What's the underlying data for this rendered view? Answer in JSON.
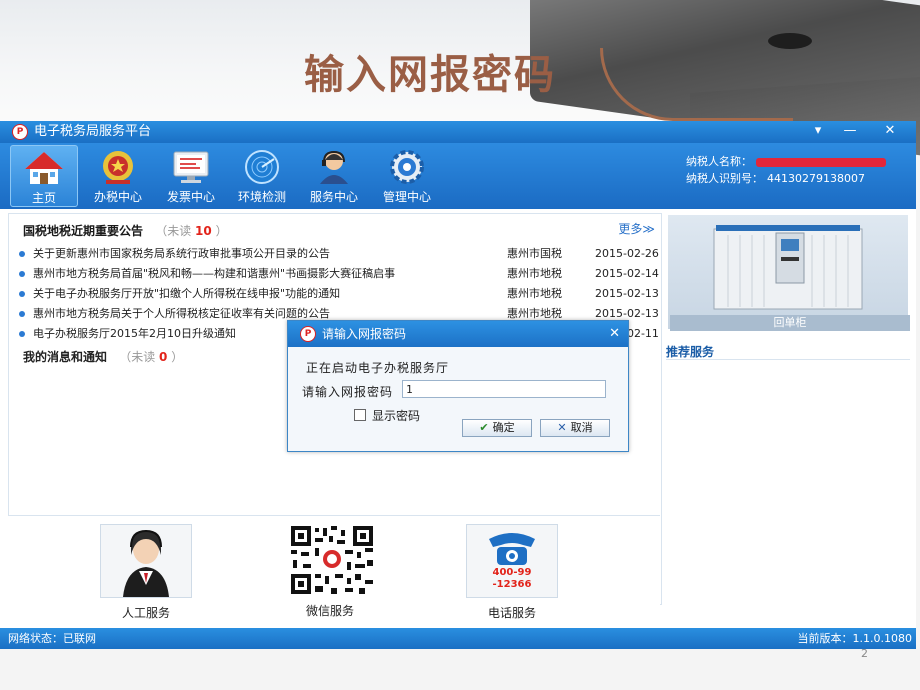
{
  "slide": {
    "title": "输入网报密码",
    "page_number": "2"
  },
  "app": {
    "title": "电子税务局服务平台",
    "window_controls": [
      "▾",
      "—",
      "✕"
    ],
    "toolbar": [
      {
        "label": "主页",
        "icon": "home-icon",
        "active": true
      },
      {
        "label": "办税中心",
        "icon": "tax-emblem-icon",
        "active": false
      },
      {
        "label": "发票中心",
        "icon": "invoice-monitor-icon",
        "active": false
      },
      {
        "label": "环境检测",
        "icon": "radar-icon",
        "active": false
      },
      {
        "label": "服务中心",
        "icon": "support-agent-icon",
        "active": false
      },
      {
        "label": "管理中心",
        "icon": "gear-icon",
        "active": false
      }
    ],
    "taxpayer": {
      "name_label": "纳税人名称：",
      "id_label": "纳税人识别号：",
      "id_value": "44130279138007"
    },
    "news": {
      "header": "国税地税近期重要公告",
      "unread_prefix": "（未读",
      "unread_count": "10",
      "unread_suffix": "）",
      "more": "更多≫",
      "items": [
        {
          "title": "关于更新惠州市国家税务局系统行政审批事项公开目录的公告",
          "source": "惠州市国税",
          "date": "2015-02-26"
        },
        {
          "title": "惠州市地方税务局首届\"税风和畅——构建和谐惠州\"书画摄影大赛征稿启事",
          "source": "惠州市地税",
          "date": "2015-02-14"
        },
        {
          "title": "关于电子办税服务厅开放\"扣缴个人所得税在线申报\"功能的通知",
          "source": "惠州市地税",
          "date": "2015-02-13"
        },
        {
          "title": "惠州市地方税务局关于个人所得税核定征收率有关问题的公告",
          "source": "惠州市地税",
          "date": "2015-02-13"
        },
        {
          "title": "电子办税服务厅2015年2月10日升级通知",
          "source": "",
          "date": "2015-02-11"
        }
      ]
    },
    "messages": {
      "header": "我的消息和通知",
      "unread_prefix": "（未读",
      "unread_count": "0",
      "unread_suffix": "）"
    },
    "services": [
      {
        "label": "人工服务",
        "icon": "customer-service-agent-icon"
      },
      {
        "label": "微信服务",
        "icon": "qr-code-icon"
      },
      {
        "label": "电话服务",
        "icon": "telephone-icon",
        "phone": "400-99\n-12366"
      }
    ],
    "right_panel": {
      "promo_caption": "回单柜",
      "recommend": "推荐服务"
    },
    "status": {
      "network": "网络状态：已联网",
      "version": "当前版本：1.1.0.1080"
    }
  },
  "dialog": {
    "title": "请输入网报密码",
    "message": "正在启动电子办税服务厅",
    "password_label": "请输入网报密码",
    "password_value": "1",
    "show_password_label": "显示密码",
    "ok_label": "确定",
    "cancel_label": "取消",
    "close": "✕"
  },
  "colors": {
    "accent": "#1b6bc3",
    "title_color": "#9a5e45",
    "unread": "#e2231a"
  }
}
